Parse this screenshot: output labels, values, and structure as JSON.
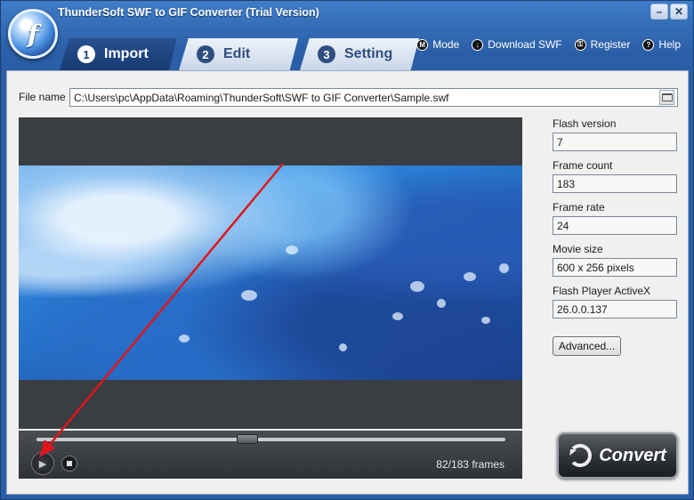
{
  "window": {
    "title": "ThunderSoft SWF to GIF Converter (Trial Version)",
    "logo_glyph": "f",
    "min_glyph": "–",
    "close_glyph": "✕"
  },
  "tabs": [
    {
      "num": "1",
      "label": "Import",
      "active": true
    },
    {
      "num": "2",
      "label": "Edit",
      "active": false
    },
    {
      "num": "3",
      "label": "Setting",
      "active": false
    }
  ],
  "toplinks": [
    {
      "icon": "mode-icon",
      "glyph": "M",
      "label": "Mode"
    },
    {
      "icon": "download-icon",
      "glyph": "↓",
      "label": "Download SWF"
    },
    {
      "icon": "key-icon",
      "glyph": "⚿",
      "label": "Register"
    },
    {
      "icon": "help-icon",
      "glyph": "?",
      "label": "Help"
    }
  ],
  "file": {
    "label": "File name",
    "value": "C:\\Users\\pc\\AppData\\Roaming\\ThunderSoft\\SWF to GIF Converter\\Sample.swf"
  },
  "player": {
    "progress": 0.45,
    "frames_text": "82/183 frames",
    "play_glyph": "▶"
  },
  "info": {
    "flash_version": {
      "label": "Flash version",
      "value": "7"
    },
    "frame_count": {
      "label": "Frame count",
      "value": "183"
    },
    "frame_rate": {
      "label": "Frame rate",
      "value": "24"
    },
    "movie_size": {
      "label": "Movie size",
      "value": "600 x 256 pixels"
    },
    "activex": {
      "label": "Flash Player ActiveX",
      "value": "26.0.0.137"
    }
  },
  "buttons": {
    "advanced": "Advanced...",
    "convert": "Convert"
  },
  "colors": {
    "frame_blue": "#2a5ea6",
    "tab_active": "#173a72",
    "annotation_arrow": "#e0161b"
  }
}
